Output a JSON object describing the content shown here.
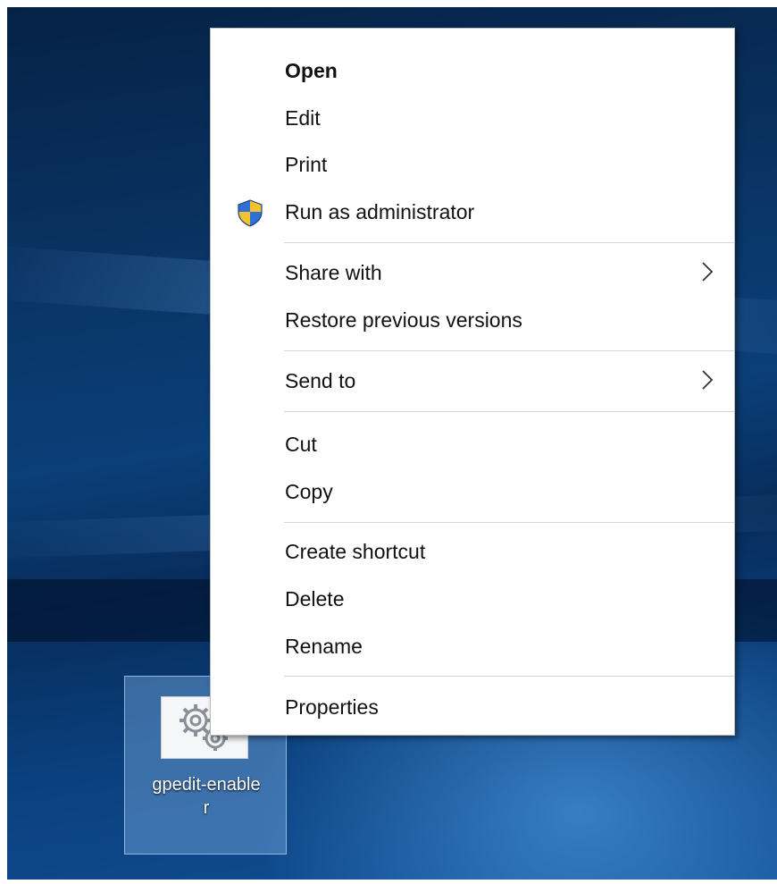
{
  "desktop": {
    "icon": {
      "name": "gpedit-enabler",
      "label_line1": "gpedit-enable",
      "label_line2": "r",
      "icon": "settings-gears-file-icon"
    }
  },
  "context_menu": {
    "items": [
      {
        "label": "Open",
        "bold": true
      },
      {
        "label": "Edit"
      },
      {
        "label": "Print"
      },
      {
        "label": "Run as administrator",
        "icon": "uac-shield-icon"
      },
      {
        "label": "Share with",
        "submenu": true
      },
      {
        "label": "Restore previous versions"
      },
      {
        "label": "Send to",
        "submenu": true
      },
      {
        "label": "Cut"
      },
      {
        "label": "Copy"
      },
      {
        "label": "Create shortcut"
      },
      {
        "label": "Delete"
      },
      {
        "label": "Rename"
      },
      {
        "label": "Properties"
      }
    ],
    "separators_after": [
      "Run as administrator",
      "Restore previous versions",
      "Send to",
      "Copy",
      "Rename"
    ]
  },
  "colors": {
    "desktop_background": "#0b3f78",
    "menu_background": "#ffffff",
    "separator": "#d6d6d6",
    "shield_blue": "#2f6fd6",
    "shield_yellow": "#f2c230"
  }
}
